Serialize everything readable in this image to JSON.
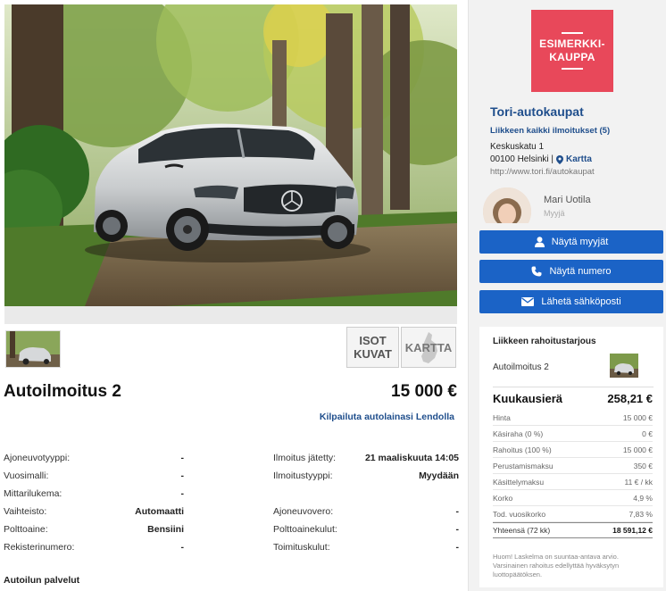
{
  "ad": {
    "title": "Autoilmoitus 2",
    "price": "15 000 €",
    "loan_link": "Kilpailuta autolainasi Lendolla",
    "gallery": {
      "big_images_label": "ISOT KUVAT",
      "map_label": "KARTTA"
    },
    "details_left": [
      {
        "label": "Ajoneuvotyyppi:",
        "value": "-"
      },
      {
        "label": "Vuosimalli:",
        "value": "-"
      },
      {
        "label": "Mittarilukema:",
        "value": "-"
      },
      {
        "label": "Vaihteisto:",
        "value": "Automaatti"
      },
      {
        "label": "Polttoaine:",
        "value": "Bensiini"
      },
      {
        "label": "Rekisterinumero:",
        "value": "-"
      }
    ],
    "details_right": [
      {
        "label": "Ilmoitus jätetty:",
        "value": "21 maaliskuuta 14:05"
      },
      {
        "label": "Ilmoitustyyppi:",
        "value": "Myydään"
      },
      {
        "label": "",
        "value": ""
      },
      {
        "label": "Ajoneuvovero:",
        "value": "-"
      },
      {
        "label": "Polttoainekulut:",
        "value": "-"
      },
      {
        "label": "Toimituskulut:",
        "value": "-"
      }
    ],
    "services_heading": "Autoilun palvelut"
  },
  "shop": {
    "logo_text": "ESIMERKKI-\nKAUPPA",
    "logo_color": "#e8485a",
    "name": "Tori-autokaupat",
    "all_ads_link": "Liikkeen kaikki ilmoitukset (5)",
    "address_line1": "Keskuskatu 1",
    "address_line2": "00100 Helsinki |",
    "map_link": "Kartta",
    "url": "http://www.tori.fi/autokaupat",
    "seller_name": "Mari Uotila",
    "seller_role": "Myyjä"
  },
  "buttons": {
    "show_sellers": "Näytä myyjät",
    "show_number": "Näytä numero",
    "send_email": "Lähetä sähköposti",
    "button_color": "#1b63c6"
  },
  "financing": {
    "title": "Liikkeen rahoitustarjous",
    "car": "Autoilmoitus 2",
    "monthly_label": "Kuukausierä",
    "monthly_value": "258,21 €",
    "rows": [
      {
        "label": "Hinta",
        "value": "15 000 €"
      },
      {
        "label": "Käsiraha (0 %)",
        "value": "0 €"
      },
      {
        "label": "Rahoitus (100 %)",
        "value": "15 000 €"
      },
      {
        "label": "Perustamismaksu",
        "value": "350 €"
      },
      {
        "label": "Käsittelymaksu",
        "value": "11 € / kk"
      },
      {
        "label": "Korko",
        "value": "4,9 %"
      },
      {
        "label": "Tod. vuosikorko",
        "value": "7,83 %"
      }
    ],
    "total_label": "Yhteensä (72 kk)",
    "total_value": "18 591,12 €",
    "note": "Huom! Laskelma on suuntaa-antava arvio. Varsinainen rahoitus edellyttää hyväksytyn luottopäätöksen."
  }
}
